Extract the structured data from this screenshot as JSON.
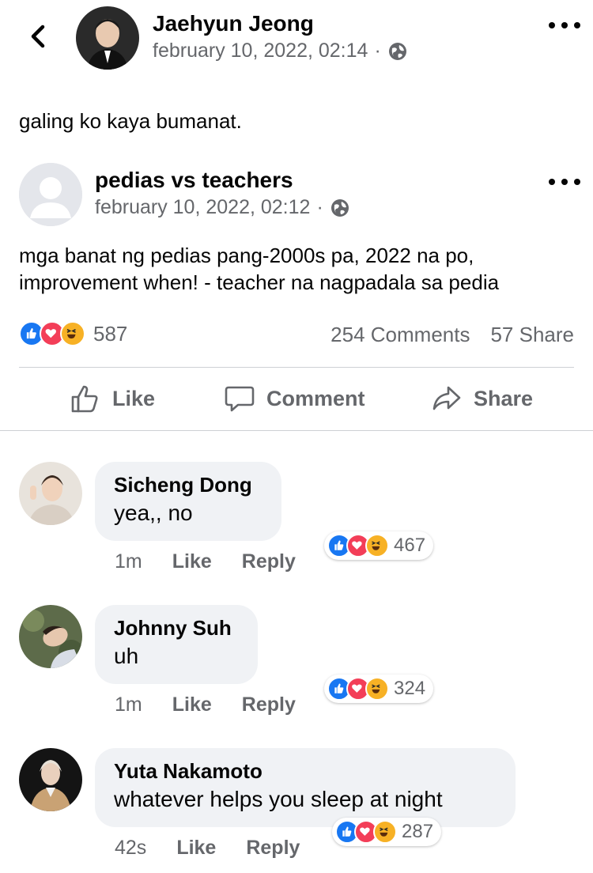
{
  "header": {
    "author_name": "Jaehyun Jeong",
    "timestamp": "february 10, 2022, 02:14",
    "separator": "·"
  },
  "post": {
    "text": "galing ko kaya bumanat."
  },
  "shared_post": {
    "author_name": "pedias vs teachers",
    "timestamp": "february 10, 2022, 02:12",
    "separator": "·",
    "text_line1": "mga banat ng pedias pang-2000s pa, 2022 na po,",
    "text_line2": "improvement when! - teacher na nagpadala sa pedia"
  },
  "stats": {
    "reaction_count": "587",
    "comments": "254 Comments",
    "shares": "57 Share"
  },
  "actions": {
    "like": "Like",
    "comment": "Comment",
    "share": "Share"
  },
  "comments": [
    {
      "name": "Sicheng Dong",
      "text": "yea,, no",
      "time": "1m",
      "like": "Like",
      "reply": "Reply",
      "reactions": "467"
    },
    {
      "name": "Johnny Suh",
      "text": "uh",
      "time": "1m",
      "like": "Like",
      "reply": "Reply",
      "reactions": "324"
    },
    {
      "name": "Yuta Nakamoto",
      "text": "whatever helps you sleep at night",
      "time": "42s",
      "like": "Like",
      "reply": "Reply",
      "reactions": "287"
    }
  ],
  "colors": {
    "like": "#1877f2",
    "love": "#f33e58",
    "haha": "#f7b125",
    "secondary_text": "#65676b",
    "bubble": "#f0f2f5"
  }
}
